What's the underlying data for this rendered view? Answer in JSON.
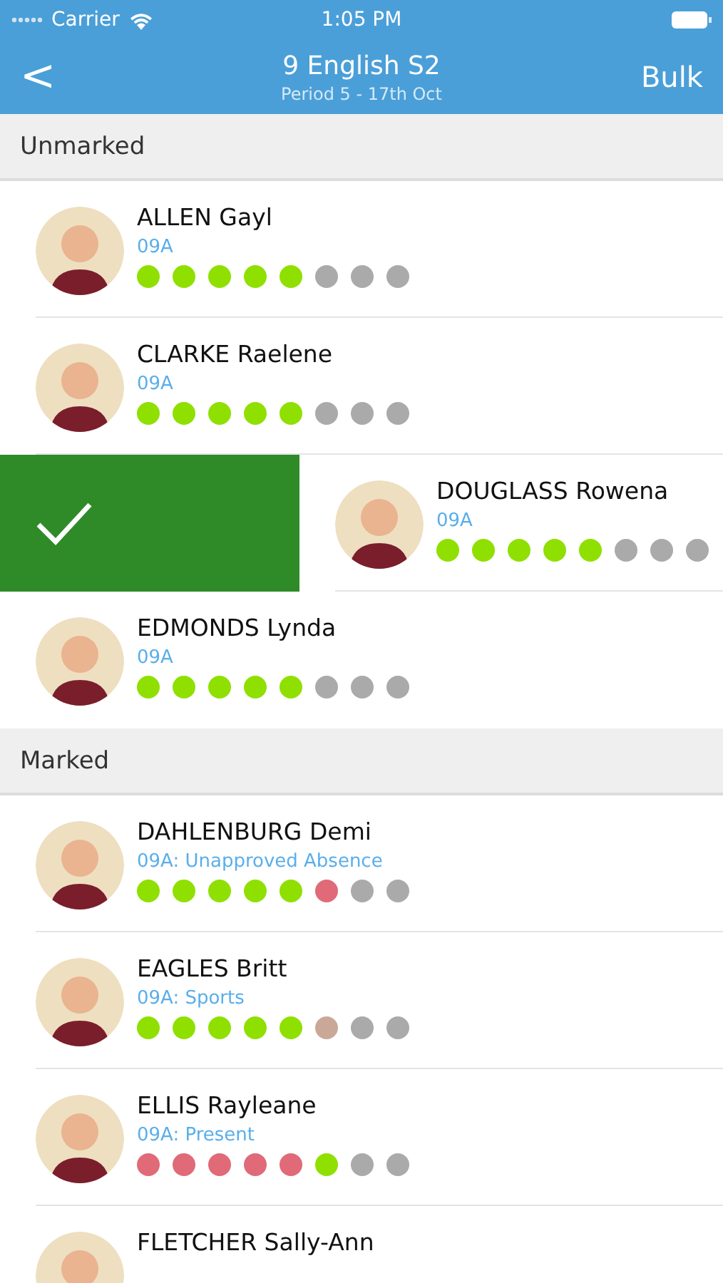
{
  "status_bar": {
    "carrier": "Carrier",
    "time": "1:05 PM"
  },
  "nav": {
    "back": "<",
    "title": "9 English S2",
    "subtitle": "Period 5 - 17th Oct",
    "action": "Bulk"
  },
  "sections": [
    {
      "title": "Unmarked",
      "students": [
        {
          "name": "ALLEN Gayl",
          "detail": "09A",
          "swiped": false,
          "dots": [
            {
              "color": "#8fe000"
            },
            {
              "color": "#8fe000"
            },
            {
              "color": "#8fe000"
            },
            {
              "color": "#8fe000"
            },
            {
              "color": "#8fe000"
            },
            {
              "color": "#aaaaaa"
            },
            {
              "color": "#aaaaaa"
            },
            {
              "color": "#aaaaaa"
            }
          ]
        },
        {
          "name": "CLARKE Raelene",
          "detail": "09A",
          "swiped": false,
          "dots": [
            {
              "color": "#8fe000"
            },
            {
              "color": "#8fe000"
            },
            {
              "color": "#8fe000"
            },
            {
              "color": "#8fe000"
            },
            {
              "color": "#8fe000"
            },
            {
              "color": "#aaaaaa"
            },
            {
              "color": "#aaaaaa"
            },
            {
              "color": "#aaaaaa"
            }
          ]
        },
        {
          "name": "DOUGLASS Rowena",
          "detail": "09A",
          "swiped": true,
          "dots": [
            {
              "color": "#8fe000"
            },
            {
              "color": "#8fe000"
            },
            {
              "color": "#8fe000"
            },
            {
              "color": "#8fe000"
            },
            {
              "color": "#8fe000"
            },
            {
              "color": "#aaaaaa"
            },
            {
              "color": "#aaaaaa"
            },
            {
              "color": "#aaaaaa"
            }
          ]
        },
        {
          "name": "EDMONDS Lynda",
          "detail": "09A",
          "swiped": false,
          "dots": [
            {
              "color": "#8fe000"
            },
            {
              "color": "#8fe000"
            },
            {
              "color": "#8fe000"
            },
            {
              "color": "#8fe000"
            },
            {
              "color": "#8fe000"
            },
            {
              "color": "#aaaaaa"
            },
            {
              "color": "#aaaaaa"
            },
            {
              "color": "#aaaaaa"
            }
          ]
        }
      ]
    },
    {
      "title": "Marked",
      "students": [
        {
          "name": "DAHLENBURG Demi",
          "detail": "09A: Unapproved Absence",
          "swiped": false,
          "dots": [
            {
              "color": "#8fe000"
            },
            {
              "color": "#8fe000"
            },
            {
              "color": "#8fe000"
            },
            {
              "color": "#8fe000"
            },
            {
              "color": "#8fe000"
            },
            {
              "color": "#e06a78"
            },
            {
              "color": "#aaaaaa"
            },
            {
              "color": "#aaaaaa"
            }
          ]
        },
        {
          "name": "EAGLES Britt",
          "detail": "09A: Sports",
          "swiped": false,
          "dots": [
            {
              "color": "#8fe000"
            },
            {
              "color": "#8fe000"
            },
            {
              "color": "#8fe000"
            },
            {
              "color": "#8fe000"
            },
            {
              "color": "#8fe000"
            },
            {
              "color": "#c9a898"
            },
            {
              "color": "#aaaaaa"
            },
            {
              "color": "#aaaaaa"
            }
          ]
        },
        {
          "name": "ELLIS Rayleane",
          "detail": "09A: Present",
          "swiped": false,
          "dots": [
            {
              "color": "#e06a78"
            },
            {
              "color": "#e06a78"
            },
            {
              "color": "#e06a78"
            },
            {
              "color": "#e06a78"
            },
            {
              "color": "#e06a78"
            },
            {
              "color": "#8fe000"
            },
            {
              "color": "#aaaaaa"
            },
            {
              "color": "#aaaaaa"
            }
          ]
        },
        {
          "name": "FLETCHER Sally-Ann",
          "swiped": false
        }
      ]
    }
  ]
}
